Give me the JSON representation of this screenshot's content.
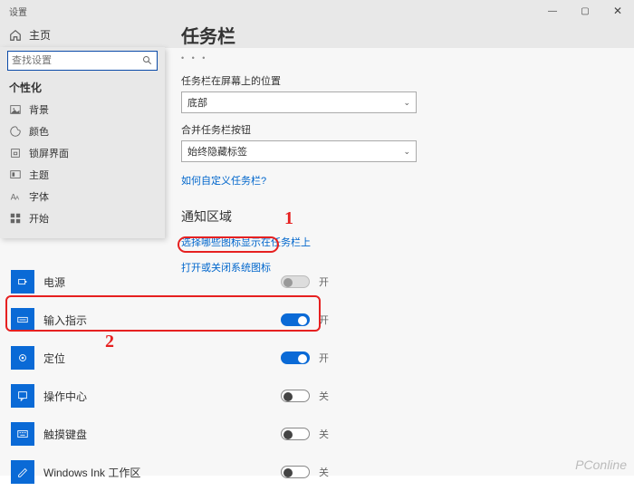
{
  "window": {
    "title": "设置",
    "min": "—",
    "max": "▢",
    "close": "✕"
  },
  "home": {
    "label": "主页"
  },
  "search": {
    "placeholder": "查找设置"
  },
  "sidebar": {
    "category": "个性化",
    "items": [
      {
        "label": "背景",
        "icon": "image"
      },
      {
        "label": "颜色",
        "icon": "palette"
      },
      {
        "label": "锁屏界面",
        "icon": "lock"
      },
      {
        "label": "主题",
        "icon": "theme"
      },
      {
        "label": "字体",
        "icon": "font"
      },
      {
        "label": "开始",
        "icon": "start"
      }
    ]
  },
  "page": {
    "title": "任务栏",
    "dots": "• • •",
    "position_label": "任务栏在屏幕上的位置",
    "position_value": "底部",
    "combine_label": "合并任务栏按钮",
    "combine_value": "始终隐藏标签",
    "customize_link": "如何自定义任务栏?",
    "notif_header": "通知区域",
    "link_icons": "选择哪些图标显示在任务栏上",
    "link_system": "打开或关闭系统图标"
  },
  "toggles": [
    {
      "label": "电源",
      "icon": "power",
      "on": false,
      "disabled": true,
      "state": "开"
    },
    {
      "label": "输入指示",
      "icon": "keyboard",
      "on": true,
      "disabled": false,
      "state": "开"
    },
    {
      "label": "定位",
      "icon": "location",
      "on": true,
      "disabled": false,
      "state": "开"
    },
    {
      "label": "操作中心",
      "icon": "action",
      "on": false,
      "disabled": false,
      "state": "关"
    },
    {
      "label": "触摸键盘",
      "icon": "touchkb",
      "on": false,
      "disabled": false,
      "state": "关"
    },
    {
      "label": "Windows Ink 工作区",
      "icon": "ink",
      "on": false,
      "disabled": false,
      "state": "关"
    }
  ],
  "annotations": {
    "one": "1",
    "two": "2"
  },
  "watermark": "PConline"
}
